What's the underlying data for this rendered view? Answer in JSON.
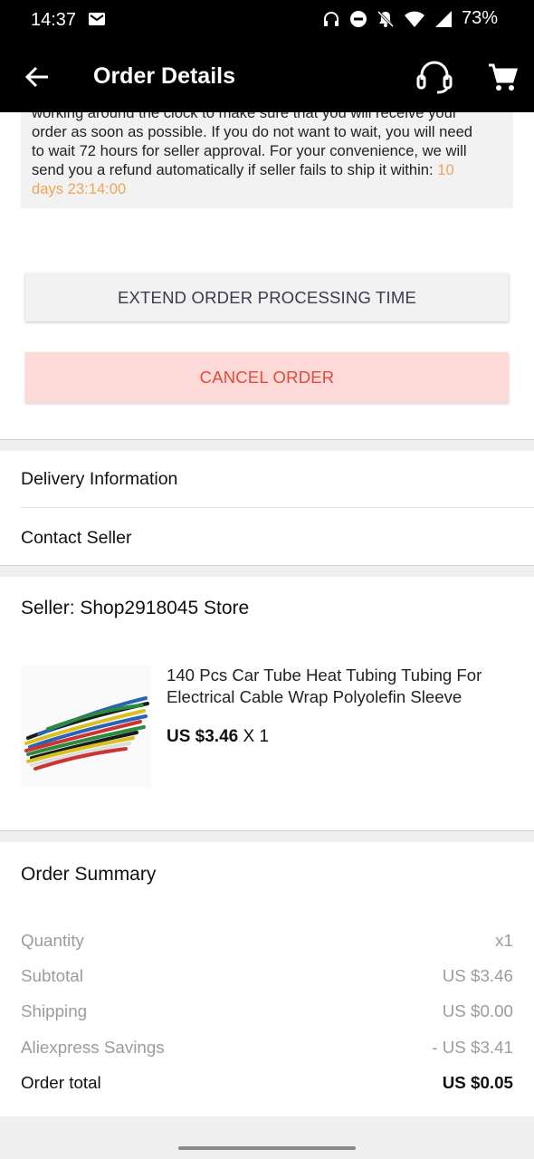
{
  "status_bar": {
    "time": "14:37",
    "battery": "73%",
    "icons": [
      "mail-icon",
      "headphones-icon",
      "dnd-icon",
      "bell-off-icon",
      "wifi-icon",
      "signal-icon"
    ]
  },
  "app_bar": {
    "title": "Order Details",
    "icons": [
      "back-arrow-icon",
      "headset-support-icon",
      "cart-icon"
    ]
  },
  "notice": {
    "text_lines": [
      "working around the clock to make sure that you will receive your",
      "order as soon as possible. If you do not want to wait, you will need",
      "to wait 72 hours for seller approval. For your convenience, we will",
      "send you a refund automatically if seller fails to ship it within: "
    ],
    "countdown_a": "10",
    "countdown_b": "days 23:14:00"
  },
  "actions": {
    "extend_label": "EXTEND ORDER PROCESSING TIME",
    "cancel_label": "CANCEL ORDER"
  },
  "links": {
    "delivery": "Delivery Information",
    "contact": "Contact Seller"
  },
  "seller": {
    "label": "Seller: Shop2918045 Store"
  },
  "product": {
    "title": "140 Pcs Car Tube Heat Tubing Tubing For Electrical Cable Wrap Polyolefin Sleeve",
    "price": "US $3.46",
    "quantity": "X 1"
  },
  "summary": {
    "title": "Order Summary",
    "rows": [
      {
        "label": "Quantity",
        "value": "x1"
      },
      {
        "label": "Subtotal",
        "value": "US $3.46"
      },
      {
        "label": "Shipping",
        "value": "US $0.00"
      },
      {
        "label": "Aliexpress Savings",
        "value": "- US $3.41"
      }
    ],
    "total": {
      "label": "Order total",
      "value": "US $0.05"
    }
  },
  "colors": {
    "accent_orange": "#f0a35a",
    "cancel_text": "#e44a3a",
    "cancel_bg": "#fddad7"
  }
}
